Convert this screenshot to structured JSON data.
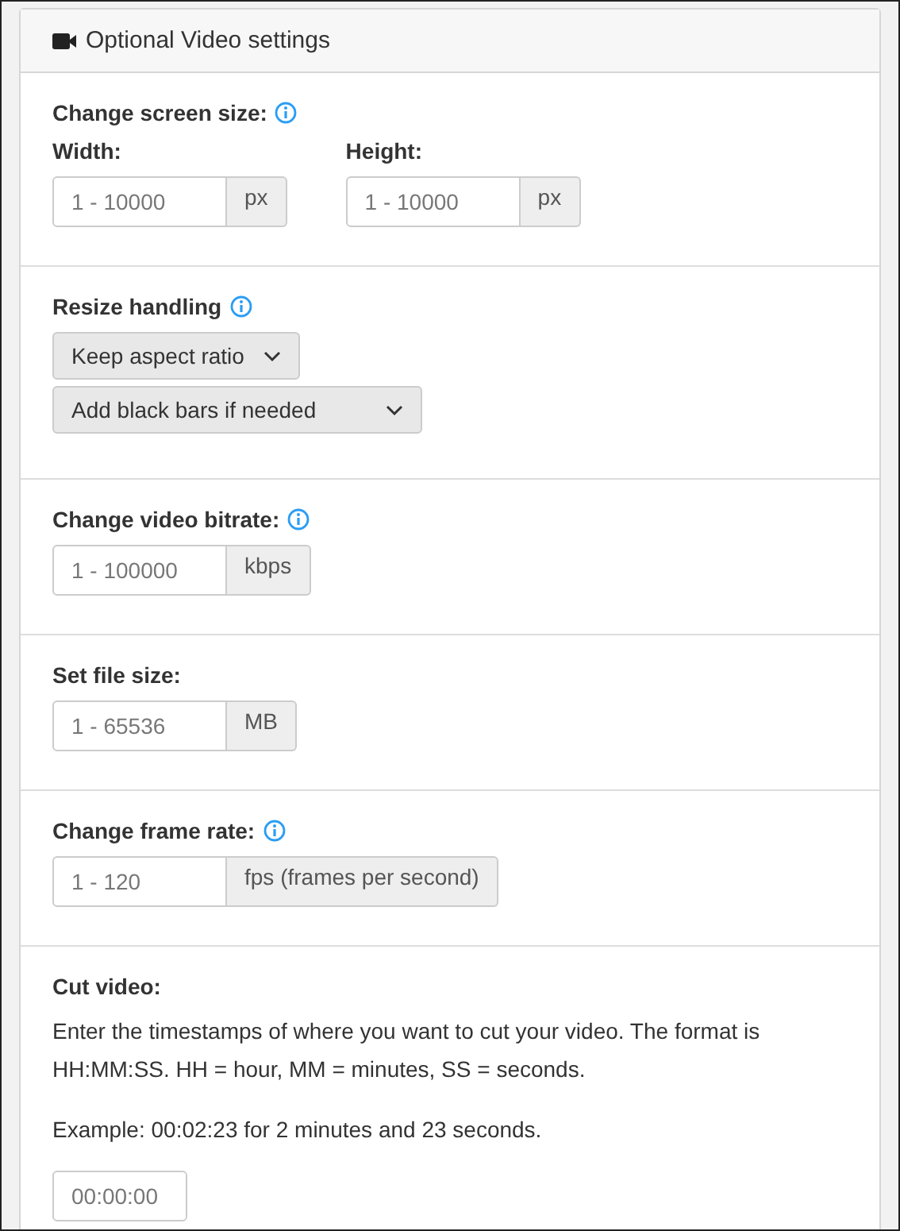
{
  "panel": {
    "title": "Optional Video settings"
  },
  "sections": [
    {
      "kind": "pair",
      "label": "Change screen size:",
      "info": true,
      "fields": [
        {
          "label": "Width:",
          "placeholder": "1 - 10000",
          "unit": "px"
        },
        {
          "label": "Height:",
          "placeholder": "1 - 10000",
          "unit": "px"
        }
      ]
    },
    {
      "kind": "selects",
      "label": "Resize handling",
      "info": true,
      "selects": [
        "Keep aspect ratio",
        "Add black bars if needed"
      ]
    },
    {
      "kind": "input",
      "label": "Change video bitrate:",
      "info": true,
      "placeholder": "1 - 100000",
      "unit": "kbps"
    },
    {
      "kind": "input",
      "label": "Set file size:",
      "info": false,
      "placeholder": "1 - 65536",
      "unit": "MB"
    },
    {
      "kind": "input",
      "label": "Change frame rate:",
      "info": true,
      "placeholder": "1 - 120",
      "unit": "fps (frames per second)"
    },
    {
      "kind": "text",
      "label": "Cut video:",
      "info": false,
      "paragraphs": [
        "Enter the timestamps of where you want to cut your video. The format is HH:MM:SS. HH = hour, MM = minutes, SS = seconds.",
        "Example: 00:02:23 for 2 minutes and 23 seconds."
      ],
      "placeholder": "00:00:00"
    }
  ]
}
